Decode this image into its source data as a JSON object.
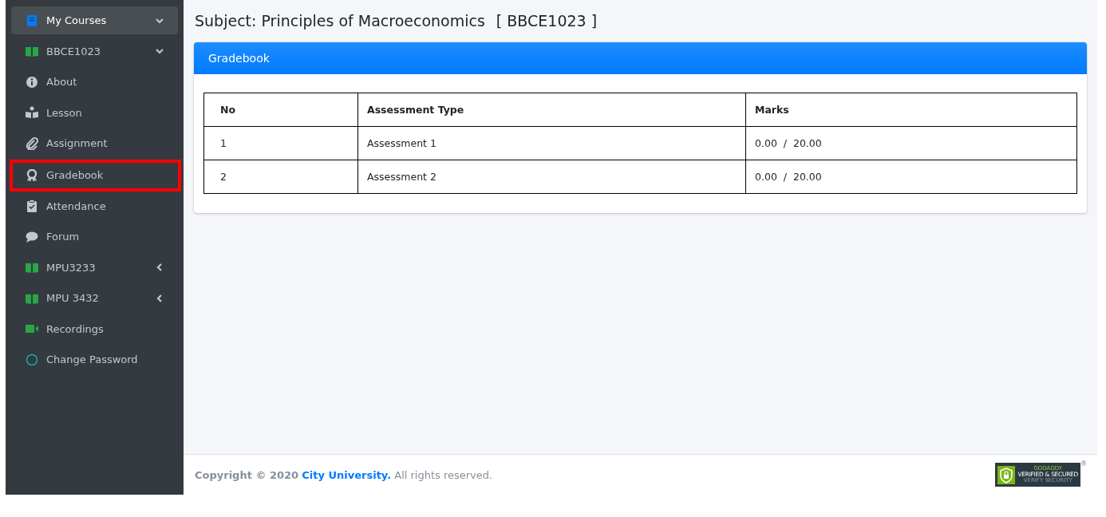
{
  "sidebar": {
    "items": [
      {
        "label": "My Courses",
        "selected": true,
        "highlighted": false,
        "expanded": true,
        "children": [
          {
            "label": "BBCE1023",
            "selected": false,
            "highlighted": false,
            "expanded": true,
            "children": [
              {
                "label": "About",
                "selected": false,
                "highlighted": false
              },
              {
                "label": "Lesson",
                "selected": false,
                "highlighted": false
              },
              {
                "label": "Assignment",
                "selected": false,
                "highlighted": false
              },
              {
                "label": "Gradebook",
                "selected": false,
                "highlighted": true
              },
              {
                "label": "Attendance",
                "selected": false,
                "highlighted": false
              },
              {
                "label": "Forum",
                "selected": false,
                "highlighted": false
              }
            ]
          },
          {
            "label": "MPU3233",
            "selected": false,
            "highlighted": false,
            "expanded": false
          },
          {
            "label": "MPU 3432",
            "selected": false,
            "highlighted": false,
            "expanded": false
          }
        ]
      },
      {
        "label": "Recordings",
        "selected": false,
        "highlighted": false
      },
      {
        "label": "Change Password",
        "selected": false,
        "highlighted": false
      }
    ]
  },
  "subject": {
    "title": "Subject: Principles of Macroeconomics",
    "code": "[ BBCE1023 ]"
  },
  "card": {
    "title": "Gradebook",
    "table": {
      "columns": [
        "No",
        "Assessment Type",
        "Marks"
      ],
      "rows": [
        [
          "1",
          "Assessment 1",
          "0.00  /  20.00"
        ],
        [
          "2",
          "Assessment 2",
          "0.00  /  20.00"
        ]
      ]
    }
  },
  "footer": {
    "prefix": "Copyright © 2020",
    "link": "City University.",
    "suffix": "All rights reserved."
  },
  "badge": {
    "brand": "GODADDY",
    "title": "VERIFIED & SECURED",
    "subtitle": "VERIFY SECURITY",
    "mark": "®"
  }
}
